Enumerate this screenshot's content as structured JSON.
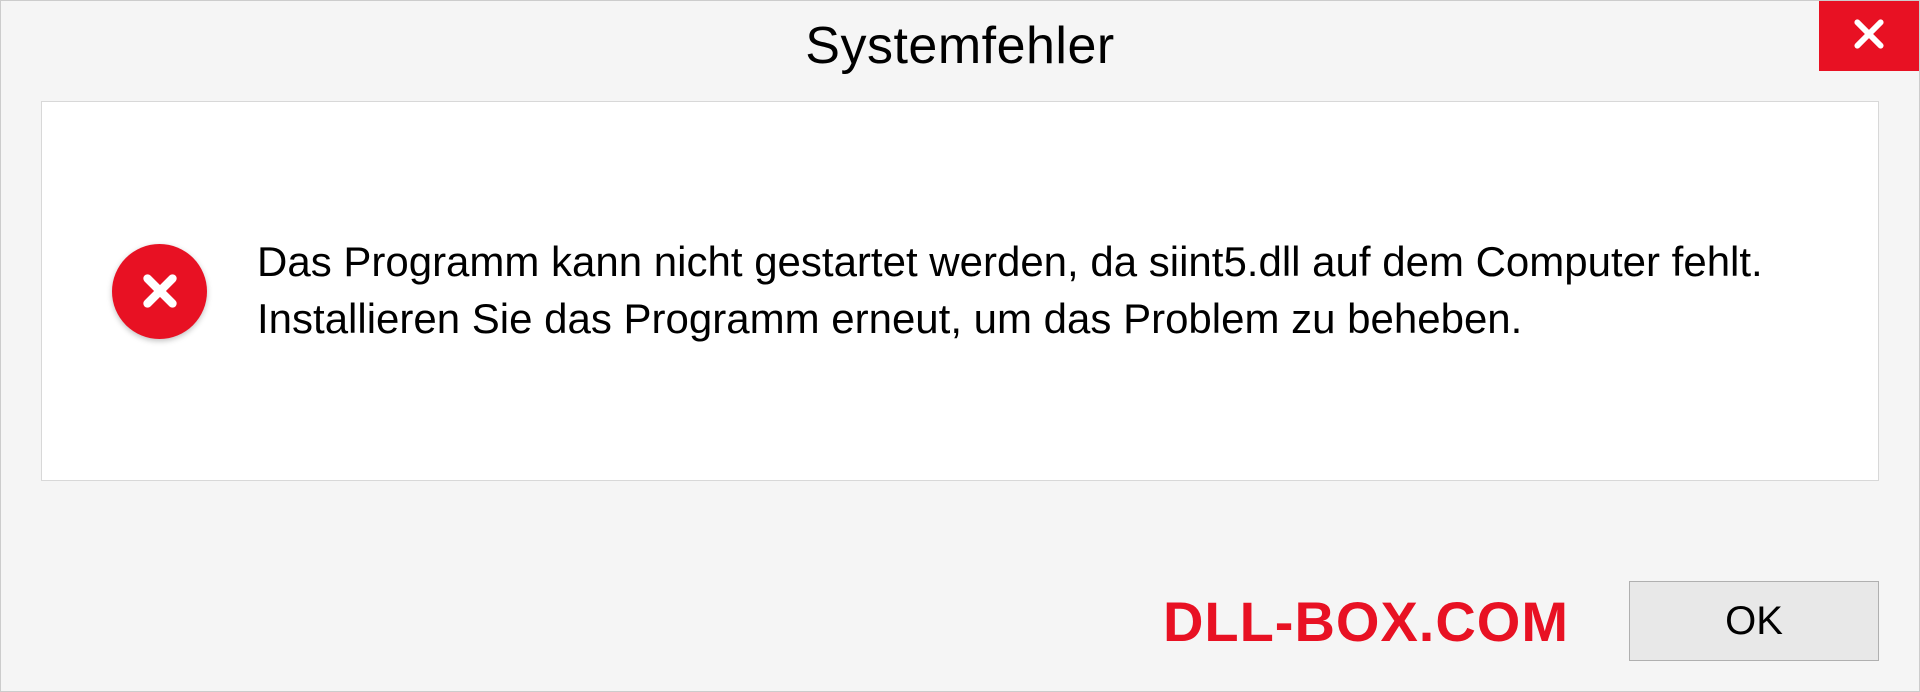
{
  "dialog": {
    "title": "Systemfehler",
    "message": "Das Programm kann nicht gestartet werden, da siint5.dll auf dem Computer fehlt. Installieren Sie das Programm erneut, um das Problem zu beheben.",
    "ok_label": "OK"
  },
  "watermark": "DLL-BOX.COM"
}
